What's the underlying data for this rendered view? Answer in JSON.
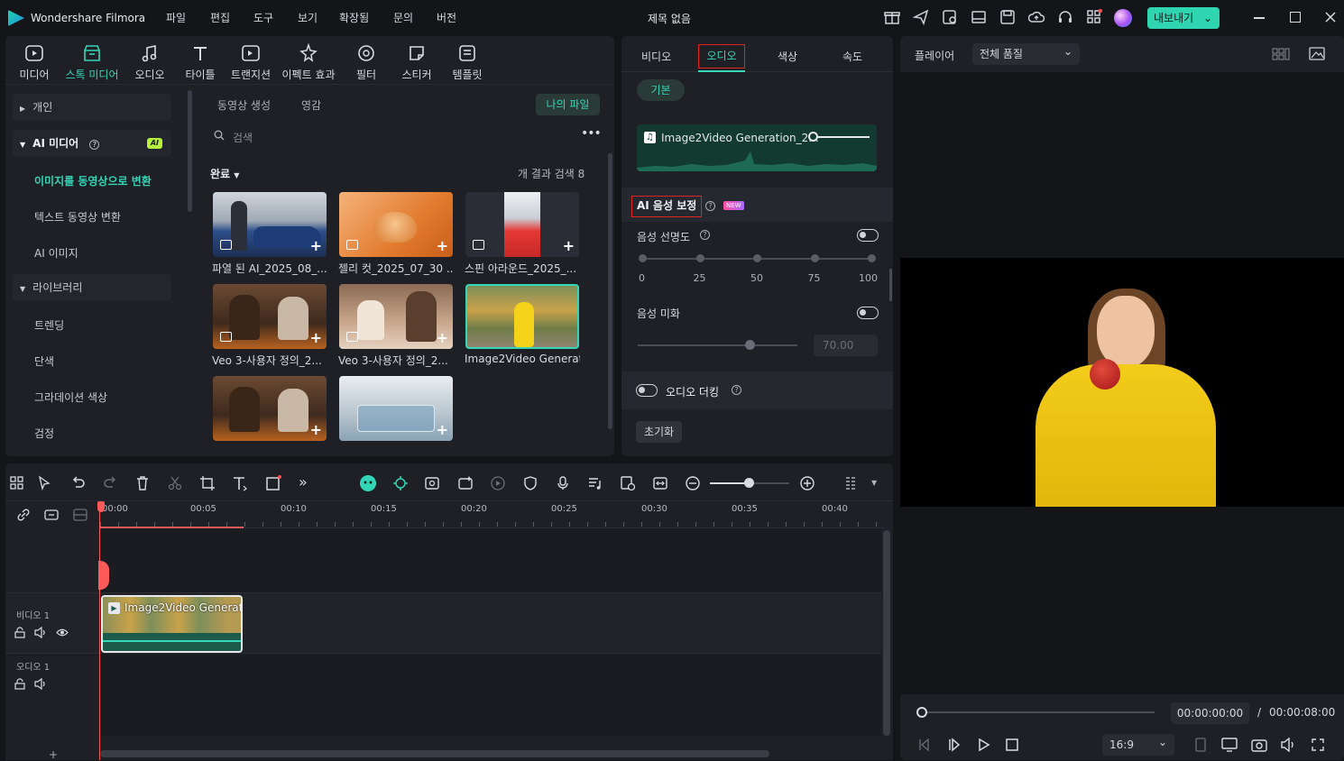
{
  "app": {
    "name": "Wondershare Filmora",
    "title": "제목 없음",
    "export_label": "내보내기"
  },
  "menu": [
    "파일",
    "편집",
    "도구",
    "보기",
    "확장됨",
    "문의",
    "버전"
  ],
  "toolbar_tabs": [
    {
      "label": "미디어",
      "icon": "media-icon"
    },
    {
      "label": "스톡 미디어",
      "icon": "stock-media-icon"
    },
    {
      "label": "오디오",
      "icon": "audio-icon"
    },
    {
      "label": "타이틀",
      "icon": "title-icon"
    },
    {
      "label": "트랜지션",
      "icon": "transition-icon"
    },
    {
      "label": "이펙트 효과",
      "icon": "effects-icon"
    },
    {
      "label": "필터",
      "icon": "filter-icon"
    },
    {
      "label": "스티커",
      "icon": "sticker-icon"
    },
    {
      "label": "템플릿",
      "icon": "template-icon"
    }
  ],
  "sidebar": {
    "personal": "개인",
    "ai_media": "AI 미디어",
    "ai_badge": "AI",
    "ai_items": [
      "이미지를 동영상으로 변환",
      "텍스트 동영상 변환",
      "AI 이미지"
    ],
    "library": "라이브러리",
    "library_items": [
      "트렌딩",
      "단색",
      "그라데이션 색상",
      "검정"
    ]
  },
  "media": {
    "subtabs": [
      "동영상 생성",
      "영감"
    ],
    "my_files": "나의 파일",
    "search_placeholder": "검색",
    "status": "완료",
    "results": "개 결과 검색 8",
    "items": [
      "파열 된 AI_2025_08_...",
      "젤리 컷_2025_07_30 ...",
      "스핀 아라운드_2025_...",
      "Veo 3-사용자 정의_2...",
      "Veo 3-사용자 정의_2...",
      "Image2Video Generat...",
      "",
      ""
    ]
  },
  "properties": {
    "tabs": [
      "비디오",
      "오디오",
      "색상",
      "속도"
    ],
    "basic": "기본",
    "clip_name": "Image2Video Generation_2...",
    "ai_voice": "AI 음성 보정",
    "new_badge": "NEW",
    "voice_clarity": "음성 선명도",
    "scale": [
      "0",
      "25",
      "50",
      "75",
      "100"
    ],
    "voice_beautify": "음성 미화",
    "beautify_value": "70.00",
    "beautify_level": 0.7,
    "audio_ducking": "오디오 더킹",
    "reset": "초기화"
  },
  "player": {
    "label": "플레이어",
    "quality": "전체 품질",
    "current_time": "00:00:00:00",
    "separator": "/",
    "total_time": "00:00:08:00",
    "aspect": "16:9"
  },
  "timeline": {
    "ruler": [
      "00:00",
      "00:05",
      "00:10",
      "00:15",
      "00:20",
      "00:25",
      "00:30",
      "00:35",
      "00:40"
    ],
    "video_track": "비디오 1",
    "audio_track": "오디오 1",
    "clip_label": "Image2Video Generati...",
    "add_track": "+"
  },
  "colors": {
    "accent": "#33d6b6",
    "highlight_box": "#e02424",
    "playhead": "#ff5a5a"
  }
}
